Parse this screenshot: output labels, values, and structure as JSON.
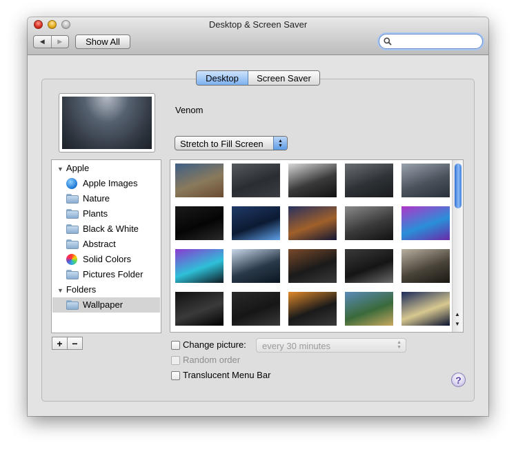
{
  "window": {
    "title": "Desktop & Screen Saver"
  },
  "toolbar": {
    "show_all_label": "Show All",
    "back_glyph": "◀",
    "forward_glyph": "▶",
    "search_placeholder": ""
  },
  "tabs": [
    {
      "label": "Desktop",
      "selected": true
    },
    {
      "label": "Screen Saver",
      "selected": false
    }
  ],
  "current_picture": {
    "name": "Venom"
  },
  "fit_popup": {
    "selected": "Stretch to Fill Screen"
  },
  "source_list": {
    "groups": [
      {
        "label": "Apple",
        "items": [
          {
            "label": "Apple Images",
            "icon": "apple-images-icon"
          },
          {
            "label": "Nature",
            "icon": "folder-icon"
          },
          {
            "label": "Plants",
            "icon": "folder-icon"
          },
          {
            "label": "Black & White",
            "icon": "folder-icon"
          },
          {
            "label": "Abstract",
            "icon": "folder-icon"
          },
          {
            "label": "Solid Colors",
            "icon": "color-wheel-icon"
          },
          {
            "label": "Pictures Folder",
            "icon": "pictures-folder-icon"
          }
        ]
      },
      {
        "label": "Folders",
        "items": [
          {
            "label": "Wallpaper",
            "icon": "folder-icon",
            "selected": true
          }
        ]
      }
    ],
    "add_label": "+",
    "remove_label": "−"
  },
  "thumbnails": [
    {
      "name": "lake-mountains",
      "colors": [
        "#3e5f86",
        "#8a7a5c",
        "#6a4a30"
      ]
    },
    {
      "name": "gray-gradient",
      "colors": [
        "#555a60",
        "#2a2d31",
        "#3a3e43"
      ]
    },
    {
      "name": "car-garage",
      "colors": [
        "#d8d8d8",
        "#3a3a3a",
        "#111111"
      ]
    },
    {
      "name": "storm-clouds",
      "colors": [
        "#6a6f73",
        "#2e3236",
        "#1a1c1e"
      ]
    },
    {
      "name": "venom-rays",
      "colors": [
        "#9aa3ad",
        "#4a525c",
        "#2a3038"
      ]
    },
    {
      "name": "dark-flowers",
      "colors": [
        "#1a1a1a",
        "#050505",
        "#2a2a2a"
      ]
    },
    {
      "name": "christmas-tree",
      "colors": [
        "#1f3a66",
        "#0c1a33",
        "#5fa0e8"
      ]
    },
    {
      "name": "night-bay",
      "colors": [
        "#28305e",
        "#a0602a",
        "#121634"
      ]
    },
    {
      "name": "bw-road",
      "colors": [
        "#8a8a8a",
        "#3a3a3a",
        "#111111"
      ]
    },
    {
      "name": "purple-cyan-waves",
      "colors": [
        "#b036c8",
        "#2a8fd8",
        "#6a2aa8"
      ]
    },
    {
      "name": "violet-waves",
      "colors": [
        "#8a3ad0",
        "#2ec0d8",
        "#101820"
      ]
    },
    {
      "name": "water-sunburst",
      "colors": [
        "#c8d8e8",
        "#2a3a4a",
        "#0a1420"
      ]
    },
    {
      "name": "planet",
      "colors": [
        "#7a4a2a",
        "#1a1a1a",
        "#3a3a3a"
      ]
    },
    {
      "name": "city-night",
      "colors": [
        "#3a3a3a",
        "#151515",
        "#6a6a6a"
      ]
    },
    {
      "name": "pier-sepia",
      "colors": [
        "#b8b0a0",
        "#4a443a",
        "#1a1812"
      ]
    },
    {
      "name": "batman",
      "colors": [
        "#111111",
        "#3a3a3a",
        "#000000"
      ]
    },
    {
      "name": "dark-logo",
      "colors": [
        "#2a2a2a",
        "#161616",
        "#3a3a3a"
      ]
    },
    {
      "name": "orange-eye",
      "colors": [
        "#e08a2a",
        "#1a1a1a",
        "#3a3a3a"
      ]
    },
    {
      "name": "waterfall-cliffs",
      "colors": [
        "#5a8ab8",
        "#3a6a3a",
        "#c8a860"
      ]
    },
    {
      "name": "ship-moon",
      "colors": [
        "#1a2a5a",
        "#d8c890",
        "#0a1230"
      ]
    }
  ],
  "options": {
    "change_picture": {
      "label": "Change picture:",
      "checked": false
    },
    "interval": {
      "selected": "every 30 minutes",
      "enabled": false
    },
    "random_order": {
      "label": "Random order",
      "checked": false,
      "enabled": false
    },
    "translucent_menu_bar": {
      "label": "Translucent Menu Bar",
      "checked": false
    }
  },
  "help": {
    "label": "?"
  }
}
